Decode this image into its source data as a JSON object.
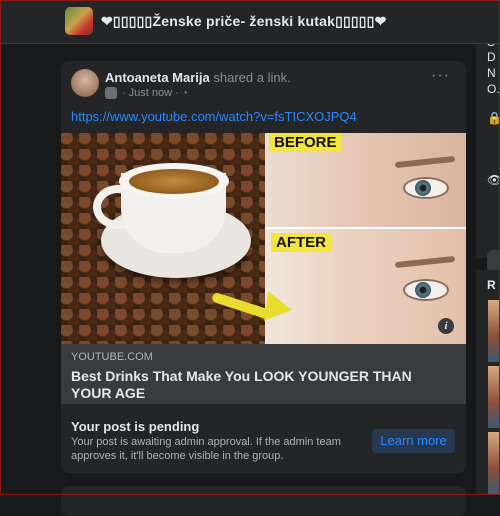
{
  "header": {
    "group_title": "❤︎▯▯▯▯▯Ženske priče- ženski kutak▯▯▯▯▯❤︎"
  },
  "post": {
    "author": "Antoaneta Marija",
    "action": " shared a link.",
    "time": "Just now",
    "more_label": "···",
    "link_url": "https://www.youtube.com/watch?v=fsTICXOJPQ4",
    "preview": {
      "before_label": "BEFORE",
      "after_label": "AFTER",
      "info_label": "i",
      "domain": "YOUTUBE.COM",
      "title": "Best Drinks That Make You LOOK YOUNGER THAN YOUR AGE"
    },
    "pending": {
      "title": "Your post is pending",
      "text": "Your post is awaiting admin approval. If the admin team approves it, it'll become visible in the group.",
      "button": "Learn more"
    }
  },
  "right_panel": {
    "lines": [
      "S",
      "D",
      "N",
      "O."
    ],
    "section_label": "R"
  },
  "colors": {
    "background": "#18191a",
    "card": "#242526",
    "link": "#2d88ff",
    "button_bg": "#263951"
  }
}
